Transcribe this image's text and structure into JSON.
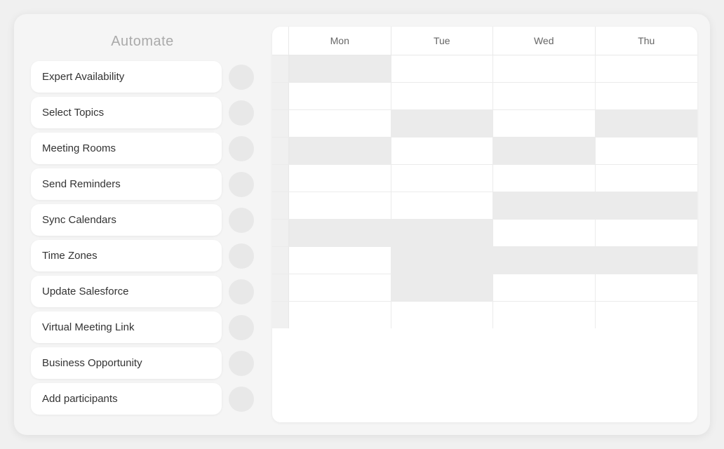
{
  "panel": {
    "title": "Automate",
    "items": [
      {
        "id": "expert-availability",
        "label": "Expert Availability"
      },
      {
        "id": "select-topics",
        "label": "Select Topics"
      },
      {
        "id": "meeting-rooms",
        "label": "Meeting Rooms"
      },
      {
        "id": "send-reminders",
        "label": "Send Reminders"
      },
      {
        "id": "sync-calendars",
        "label": "Sync Calendars"
      },
      {
        "id": "time-zones",
        "label": "Time Zones"
      },
      {
        "id": "update-salesforce",
        "label": "Update Salesforce"
      },
      {
        "id": "virtual-meeting-link",
        "label": "Virtual Meeting Link"
      },
      {
        "id": "business-opportunity",
        "label": "Business Opportunity"
      },
      {
        "id": "add-participants",
        "label": "Add participants"
      }
    ]
  },
  "calendar": {
    "headers": [
      "Mon",
      "Tue",
      "Wed",
      "Thu"
    ],
    "rows": [
      [
        "shaded",
        "",
        "",
        ""
      ],
      [
        "",
        "",
        "",
        ""
      ],
      [
        "",
        "shaded",
        "",
        "shaded"
      ],
      [
        "shaded",
        "",
        "shaded",
        ""
      ],
      [
        "",
        "",
        "",
        ""
      ],
      [
        "",
        "",
        "shaded",
        "shaded"
      ],
      [
        "shaded",
        "shaded",
        "",
        ""
      ],
      [
        "",
        "shaded",
        "shaded",
        "shaded"
      ],
      [
        "",
        "shaded",
        "",
        ""
      ],
      [
        "",
        "",
        "",
        ""
      ]
    ]
  }
}
